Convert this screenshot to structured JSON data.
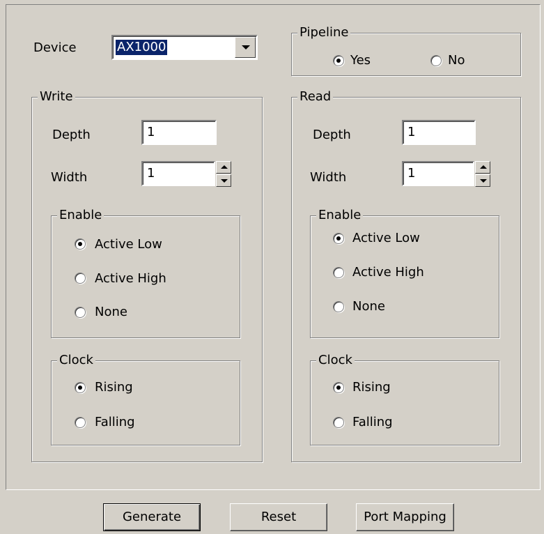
{
  "device": {
    "label": "Device",
    "value": "AX1000"
  },
  "pipeline": {
    "title": "Pipeline",
    "options": [
      "Yes",
      "No"
    ],
    "selected": "Yes"
  },
  "write": {
    "title": "Write",
    "depth_label": "Depth",
    "depth_value": "1",
    "width_label": "Width",
    "width_value": "1",
    "enable": {
      "title": "Enable",
      "options": [
        "Active Low",
        "Active High",
        "None"
      ],
      "selected": "Active Low"
    },
    "clock": {
      "title": "Clock",
      "options": [
        "Rising",
        "Falling"
      ],
      "selected": "Rising"
    }
  },
  "read": {
    "title": "Read",
    "depth_label": "Depth",
    "depth_value": "1",
    "width_label": "Width",
    "width_value": "1",
    "enable": {
      "title": "Enable",
      "options": [
        "Active Low",
        "Active High",
        "None"
      ],
      "selected": "Active Low"
    },
    "clock": {
      "title": "Clock",
      "options": [
        "Rising",
        "Falling"
      ],
      "selected": "Rising"
    }
  },
  "buttons": {
    "generate": "Generate",
    "reset": "Reset",
    "port_mapping": "Port Mapping"
  }
}
